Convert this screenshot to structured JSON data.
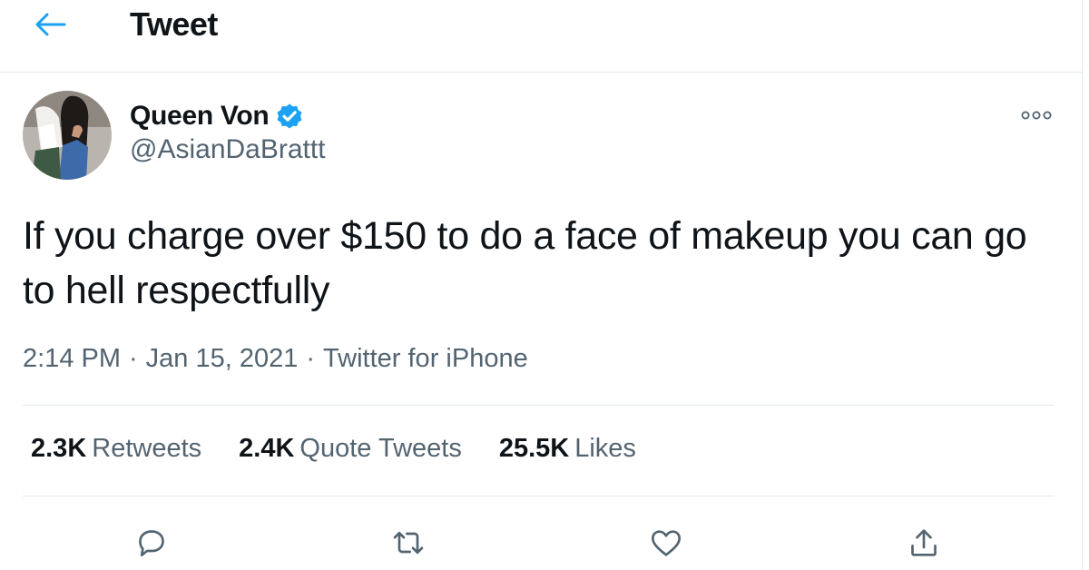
{
  "header": {
    "title": "Tweet",
    "back_icon": "arrow-left-icon",
    "accent_color": "#1da1f2"
  },
  "author": {
    "display_name": "Queen Von",
    "handle": "@AsianDaBrattt",
    "verified": true,
    "verified_icon": "verified-badge-icon"
  },
  "tweet": {
    "text": "If you charge over $150 to do a face of makeup you can go to hell respectfully",
    "time": "2:14 PM",
    "separator": "·",
    "date": "Jan 15, 2021",
    "source": "Twitter for iPhone"
  },
  "stats": {
    "retweets": {
      "count": "2.3K",
      "label": "Retweets"
    },
    "quote_tweets": {
      "count": "2.4K",
      "label": "Quote Tweets"
    },
    "likes": {
      "count": "25.5K",
      "label": "Likes"
    }
  },
  "actions": {
    "reply_icon": "reply-icon",
    "retweet_icon": "retweet-icon",
    "like_icon": "heart-icon",
    "share_icon": "share-icon"
  }
}
